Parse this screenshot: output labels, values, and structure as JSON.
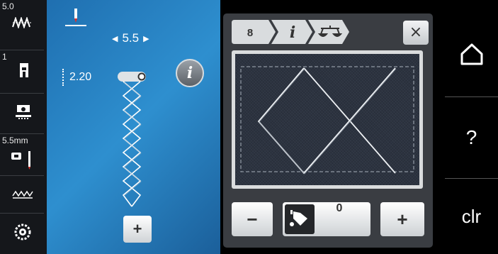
{
  "sidebar": {
    "stitch_width": "5.0",
    "presser_foot": "1",
    "needle_size": "5.5mm"
  },
  "stitch_panel": {
    "width_value": "5.5",
    "length_value": "2.20",
    "info_label": "i",
    "add_label": "+"
  },
  "dialog": {
    "crumb_number": "8",
    "crumb_info": "i",
    "close_label": "×",
    "minus_label": "−",
    "plus_label": "+",
    "balance_value": "0"
  },
  "rightbar": {
    "help_label": "?",
    "clr_label": "clr"
  },
  "colors": {
    "panel_blue": "#2e8fcf",
    "dialog_gray": "#3a3d42",
    "fabric_dark": "#2c3340"
  }
}
